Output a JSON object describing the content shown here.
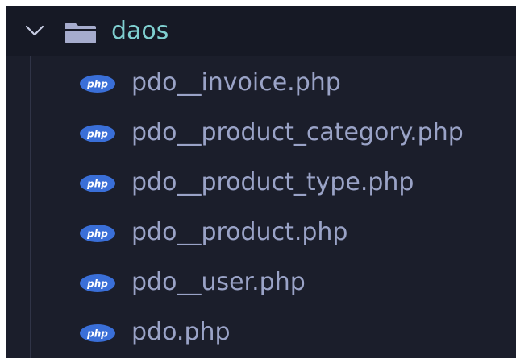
{
  "explorer": {
    "folder": {
      "name": "daos",
      "expanded": true,
      "chevron_icon": "chevron-down-icon",
      "icon": "folder-icon"
    },
    "file_icon": "php-icon",
    "php_badge_text": "php",
    "files": [
      {
        "name": "pdo__invoice.php"
      },
      {
        "name": "pdo__product_category.php"
      },
      {
        "name": "pdo__product_type.php"
      },
      {
        "name": "pdo__product.php"
      },
      {
        "name": "pdo__user.php"
      },
      {
        "name": "pdo.php"
      }
    ]
  },
  "colors": {
    "background": "#1b1e2b",
    "folder_row_background": "#161925",
    "folder_label": "#7fcfd0",
    "file_label": "#9aa3c7",
    "php_badge": "#3a6fd8",
    "folder_icon": "#a6accd"
  }
}
